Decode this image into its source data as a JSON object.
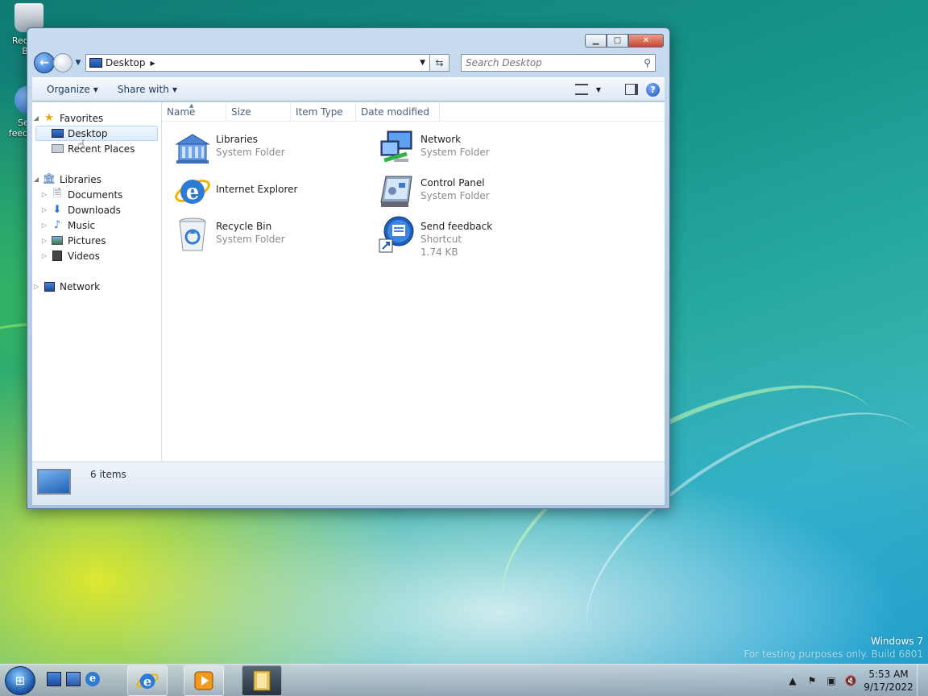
{
  "desktop": {
    "icons": [
      {
        "label": "Recycle Bin",
        "icon": "recycle-bin-icon"
      },
      {
        "label": "Send feedback",
        "icon": "feedback-icon"
      }
    ],
    "watermark": {
      "line1": "Windows 7",
      "line2": "For testing purposes only. Build 6801"
    }
  },
  "window": {
    "address": {
      "location": "Desktop"
    },
    "search": {
      "placeholder": "Search Desktop"
    },
    "toolbar": {
      "organize": "Organize",
      "share_with": "Share with"
    },
    "nav_pane": {
      "favorites": {
        "label": "Favorites",
        "items": [
          {
            "label": "Desktop"
          },
          {
            "label": "Recent Places"
          }
        ]
      },
      "libraries": {
        "label": "Libraries",
        "items": [
          {
            "label": "Documents"
          },
          {
            "label": "Downloads"
          },
          {
            "label": "Music"
          },
          {
            "label": "Pictures"
          },
          {
            "label": "Videos"
          }
        ]
      },
      "network": {
        "label": "Network"
      }
    },
    "columns": [
      "Name",
      "Size",
      "Item Type",
      "Date modified"
    ],
    "items": [
      {
        "name": "Libraries",
        "sub1": "System Folder",
        "sub2": "",
        "icon": "libraries-icon"
      },
      {
        "name": "Network",
        "sub1": "System Folder",
        "sub2": "",
        "icon": "network-icon"
      },
      {
        "name": "Internet Explorer",
        "sub1": "",
        "sub2": "",
        "icon": "internet-explorer-icon"
      },
      {
        "name": "Control Panel",
        "sub1": "System Folder",
        "sub2": "",
        "icon": "control-panel-icon"
      },
      {
        "name": "Recycle Bin",
        "sub1": "System Folder",
        "sub2": "",
        "icon": "recycle-bin-icon"
      },
      {
        "name": "Send feedback",
        "sub1": "Shortcut",
        "sub2": "1.74 KB",
        "icon": "feedback-icon"
      }
    ],
    "status": {
      "count": "6 items"
    }
  },
  "taskbar": {
    "clock": {
      "time": "5:53 AM",
      "date": "9/17/2022"
    }
  }
}
